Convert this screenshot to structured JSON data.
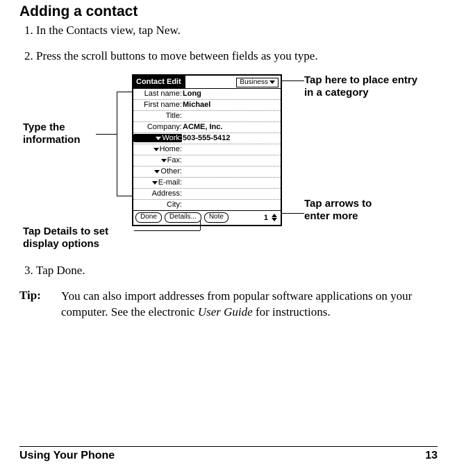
{
  "heading": "Adding a contact",
  "steps": [
    "In the Contacts view, tap New.",
    "Press the scroll buttons to move between fields as you type.",
    "Tap Done."
  ],
  "tip": {
    "label": "Tip:",
    "text_a": "You can also import addresses from popular software applications on your computer. See the electronic ",
    "italic": "User Guide",
    "text_b": " for instructions."
  },
  "callouts": {
    "type_info": "Type the information",
    "details": "Tap Details to set display options",
    "category": "Tap here to place entry in a category",
    "arrows": "Tap arrows to enter more"
  },
  "pda": {
    "title": "Contact Edit",
    "category": "Business",
    "fields": {
      "last_name": {
        "label": "Last name:",
        "value": "Long"
      },
      "first_name": {
        "label": "First name:",
        "value": "Michael"
      },
      "title": {
        "label": "Title:",
        "value": ""
      },
      "company": {
        "label": "Company:",
        "value": "ACME, Inc."
      },
      "work": {
        "label": "Work:",
        "value": "503-555-5412"
      },
      "home": {
        "label": "Home:",
        "value": ""
      },
      "fax": {
        "label": "Fax:",
        "value": ""
      },
      "other": {
        "label": "Other:",
        "value": ""
      },
      "email": {
        "label": "E-mail:",
        "value": ""
      },
      "address": {
        "label": "Address:",
        "value": ""
      },
      "city": {
        "label": "City:",
        "value": ""
      }
    },
    "buttons": {
      "done": "Done",
      "details": "Details...",
      "note": "Note"
    },
    "page": "1"
  },
  "footer": {
    "section": "Using Your Phone",
    "page": "13"
  }
}
